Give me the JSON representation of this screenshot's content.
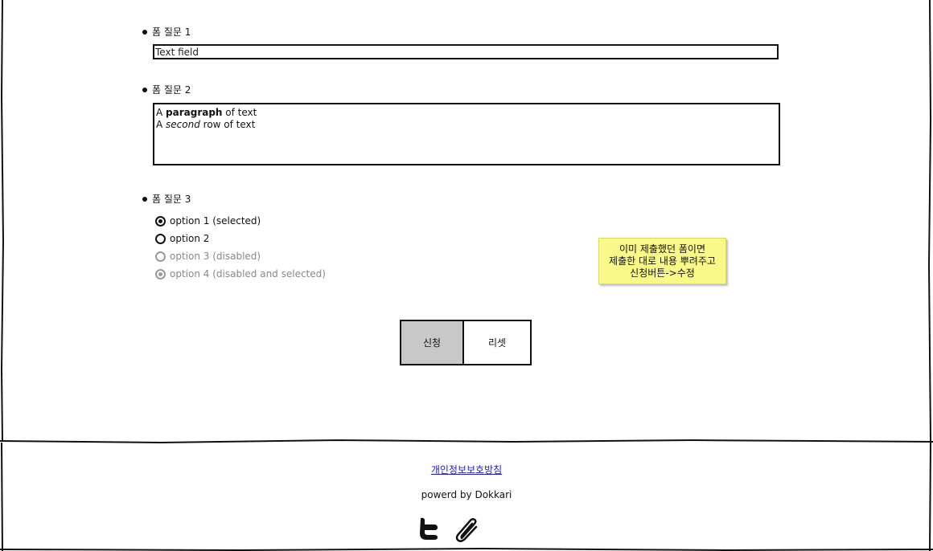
{
  "form": {
    "q1": {
      "label": "폼 질문 1",
      "input_value": "Text field"
    },
    "q2": {
      "label": "폼 질문 2",
      "line1": {
        "a": "A ",
        "bold": "paragraph",
        "rest": " of text"
      },
      "line2": {
        "a": "A ",
        "italic": "second",
        "rest": " row of text"
      }
    },
    "q3": {
      "label": "폼 질문 3",
      "options": [
        {
          "label": "option 1 (selected)",
          "selected": true,
          "disabled": false
        },
        {
          "label": "option 2",
          "selected": false,
          "disabled": false
        },
        {
          "label": "option 3 (disabled)",
          "selected": false,
          "disabled": true
        },
        {
          "label": "option 4 (disabled and selected)",
          "selected": true,
          "disabled": true
        }
      ]
    }
  },
  "note": {
    "line1": "이미 제출했던 폼이면",
    "line2": "제출한 대로 내용 뿌려주고",
    "line3": "신청버튼->수정",
    "color": "#f9f98a"
  },
  "buttons": {
    "submit_label": "신청",
    "reset_label": "리셋"
  },
  "footer": {
    "privacy_link": "개인정보보호방침",
    "powered_by": "powerd by Dokkari",
    "icons": [
      "twitter-icon",
      "paperclip-icon"
    ]
  }
}
